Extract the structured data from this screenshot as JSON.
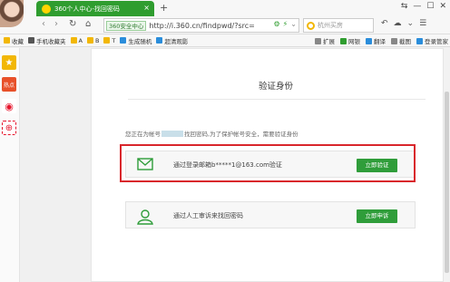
{
  "browser": {
    "tab_title": "360个人中心-找回密码",
    "tab_close": "×",
    "new_tab": "+",
    "window_controls": [
      "⇆",
      "—",
      "☐",
      "✕"
    ],
    "nav": {
      "back": "‹",
      "forward": "›",
      "reload": "↻",
      "home": "⌂"
    },
    "site_badge": "360安全中心",
    "url": "http://i.360.cn/findpwd/?src=",
    "search_placeholder": "杭州买房",
    "nav_right": [
      "↶",
      "☁",
      "⌄",
      "☰"
    ]
  },
  "bookmarks": {
    "items": [
      {
        "label": "收藏",
        "color": "#f2b705"
      },
      {
        "label": "手机收藏夹",
        "color": "#555555"
      },
      {
        "label": "A",
        "color": "#f2b705"
      },
      {
        "label": "B",
        "color": "#f2b705"
      },
      {
        "label": "T",
        "color": "#f2b705"
      },
      {
        "label": "生成随机",
        "color": "#2a8ddb"
      },
      {
        "label": "超清观影",
        "color": "#2a8ddb"
      }
    ],
    "right": [
      "扩展",
      "网银",
      "翻译",
      "截图",
      "登录管家"
    ]
  },
  "sidebar": {
    "items": [
      {
        "icon": "star-icon",
        "color": "#f2b705",
        "glyph": "★"
      },
      {
        "icon": "news-icon",
        "color": "#e8512a",
        "glyph": "热点"
      },
      {
        "icon": "weibo-icon",
        "color": "#e6162d",
        "glyph": "◉"
      },
      {
        "icon": "add-icon",
        "color": "#ffffff",
        "glyph": "⊕"
      }
    ]
  },
  "page": {
    "title": "验证身份",
    "intro_prefix": "您正在为帐号",
    "intro_suffix": "找回密码,为了保护帐号安全，需要验证身份",
    "options": [
      {
        "text": "通过登录邮箱b*****1@163.com验证",
        "button": "立即验证",
        "icon": "envelope-icon"
      },
      {
        "text": "通过人工审诉来找回密码",
        "button": "立即申诉",
        "icon": "user-icon"
      }
    ]
  },
  "colors": {
    "accent": "#2f9d3a",
    "highlight": "#d9262c",
    "tab": "#2f9d2f"
  }
}
